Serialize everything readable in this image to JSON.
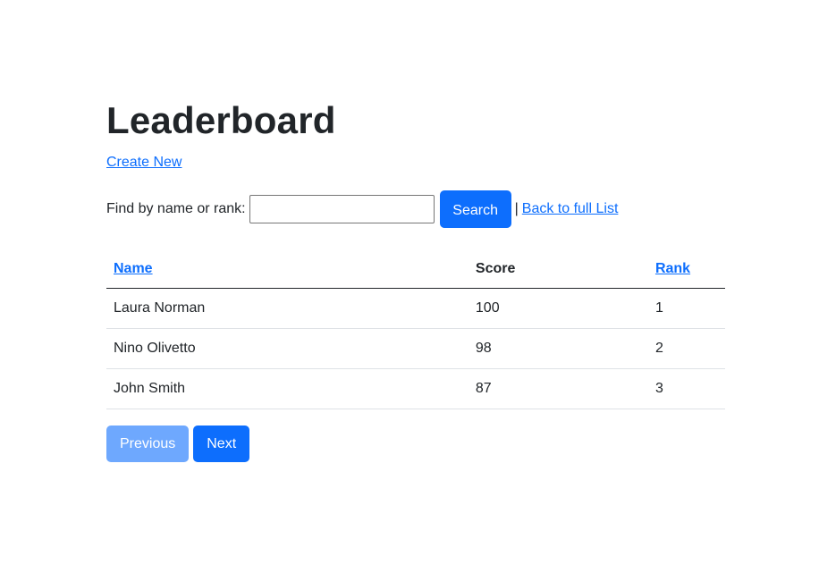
{
  "page": {
    "title": "Leaderboard",
    "create_link": "Create New"
  },
  "search": {
    "label": "Find by name or rank:",
    "value": "",
    "placeholder": "",
    "button_label": "Search",
    "separator": "|",
    "back_link": "Back to full List"
  },
  "table": {
    "headers": {
      "name": "Name",
      "score": "Score",
      "rank": "Rank"
    },
    "rows": [
      {
        "name": "Laura Norman",
        "score": "100",
        "rank": "1"
      },
      {
        "name": "Nino Olivetto",
        "score": "98",
        "rank": "2"
      },
      {
        "name": "John Smith",
        "score": "87",
        "rank": "3"
      }
    ]
  },
  "pager": {
    "previous_label": "Previous",
    "next_label": "Next"
  },
  "colors": {
    "primary": "#0d6efd",
    "primary_disabled": "#6ea8fe",
    "text": "#212529"
  }
}
